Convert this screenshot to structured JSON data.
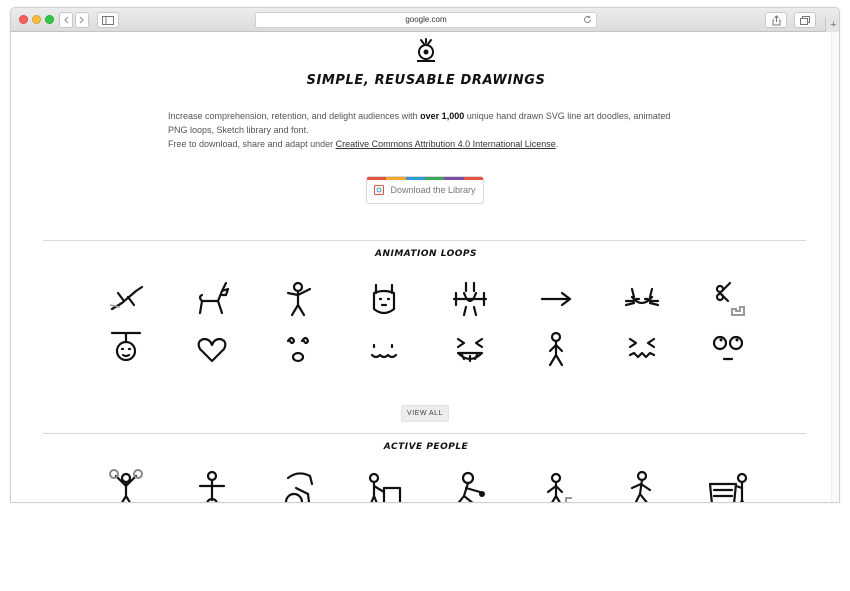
{
  "browser": {
    "url": "google.com"
  },
  "hero": {
    "headline": "SIMPLE, REUSABLE DRAWINGS",
    "intro_pre": "Increase comprehension, retention, and delight audiences with ",
    "intro_bold": "over 1,000",
    "intro_post": " unique hand drawn SVG line art doodles, animated PNG loops, Sketch library and font.",
    "license_pre": "Free to download, share and adapt under ",
    "license_link": "Creative Commons Attribution 4.0 International License",
    "license_post": ".",
    "download_label": "Download the Library",
    "stripe_colors": [
      "#e2543f",
      "#f0a62f",
      "#2f9ad6",
      "#3ca55c",
      "#7a4ea3",
      "#e2543f"
    ]
  },
  "animation_loops": {
    "title": "ANIMATION LOOPS",
    "view_all": "VIEW ALL",
    "icons": [
      "flying-superhero-icon",
      "unicorn-icon",
      "waving-person-icon",
      "llama-icon",
      "bunny-weightlifter-icon",
      "arrow-right-icon",
      "cat-face-icon",
      "scissors-cutting-icon",
      "monkey-hanging-icon",
      "heart-icon",
      "dizzy-face-icon",
      "sneaky-face-icon",
      "laughing-face-icon",
      "walking-person-icon",
      "squinting-face-icon",
      "rolling-eyes-face-icon"
    ]
  },
  "active_people": {
    "title": "ACTIVE PEOPLE",
    "icons": [
      "cheerleader-icon",
      "unicycle-juggler-icon",
      "wheelchair-icon",
      "pushing-box-icon",
      "bowling-icon",
      "stair-climber-icon",
      "running-person-icon",
      "shopping-cart-icon"
    ]
  }
}
